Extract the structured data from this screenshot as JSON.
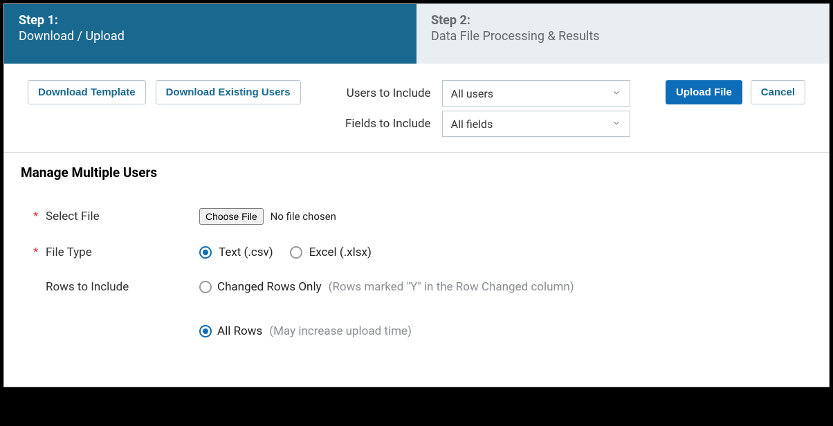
{
  "steps": {
    "active": {
      "title": "Step 1:",
      "subtitle": "Download / Upload"
    },
    "inactive": {
      "title": "Step 2:",
      "subtitle": "Data File Processing & Results"
    }
  },
  "toolbar": {
    "download_template": "Download Template",
    "download_existing": "Download Existing Users",
    "users_label": "Users to Include",
    "users_value": "All users",
    "fields_label": "Fields to Include",
    "fields_value": "All fields",
    "upload": "Upload File",
    "cancel": "Cancel"
  },
  "section_title": "Manage Multiple Users",
  "form": {
    "select_file_label": "Select File",
    "choose_file_btn": "Choose File",
    "no_file": "No file chosen",
    "file_type_label": "File Type",
    "file_type_csv": "Text (.csv)",
    "file_type_xlsx": "Excel (.xlsx)",
    "rows_label": "Rows to Include",
    "rows_changed_label": "Changed Rows Only",
    "rows_changed_hint": "(Rows marked \"Y\" in the Row Changed column)",
    "rows_all_label": "All Rows",
    "rows_all_hint": "(May increase upload time)"
  }
}
